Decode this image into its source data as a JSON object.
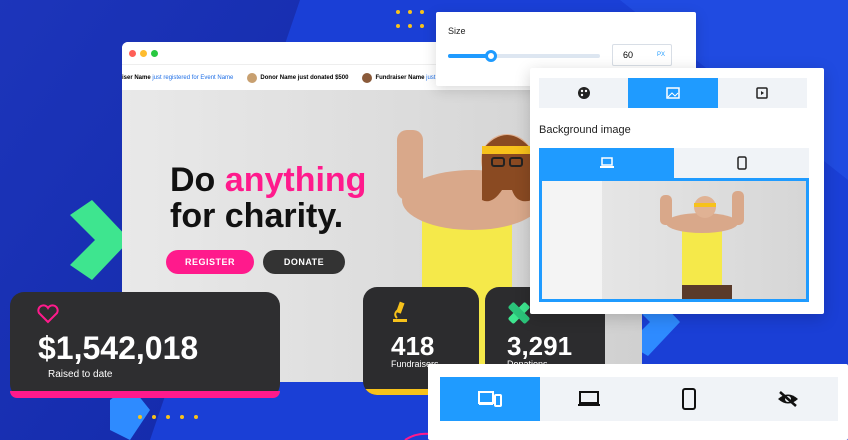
{
  "browser": {
    "ticker": [
      {
        "name": "iser Name",
        "action": "just registered for Event Name"
      },
      {
        "name": "Donor Name",
        "action": "just donated $500"
      },
      {
        "name": "Fundraiser Name",
        "action": "just registered for Eve"
      }
    ]
  },
  "hero": {
    "line1_a": "Do ",
    "line1_b": "anything",
    "line2": "for charity.",
    "register_label": "REGISTER",
    "donate_label": "DONATE",
    "accent_color": "#ff1a8c"
  },
  "stats": {
    "raised": {
      "value": "$1,542,018",
      "label": "Raised to date",
      "icon": "heart-icon"
    },
    "fundraisers": {
      "value": "418",
      "label": "Fundraisers",
      "icon": "microscope-icon"
    },
    "donations": {
      "value": "3,291",
      "label": "Donations",
      "icon": "bandage-icon"
    }
  },
  "size_panel": {
    "title": "Size",
    "value": "60",
    "unit": "PX",
    "slider_fraction": 0.28
  },
  "bg_panel": {
    "tabs": [
      "palette-icon",
      "image-icon",
      "video-icon"
    ],
    "active_tab": 1,
    "section_label": "Background image",
    "device_tabs": [
      "laptop-icon",
      "phone-icon"
    ]
  },
  "device_bar": {
    "options": [
      "responsive-icon",
      "desktop-icon",
      "mobile-icon",
      "hidden-icon"
    ],
    "active": 0
  },
  "colors": {
    "brand_blue": "#1f9bff",
    "page_bg": "#1a3fd6",
    "green": "#3ee58f",
    "yellow": "#f7c21b"
  }
}
